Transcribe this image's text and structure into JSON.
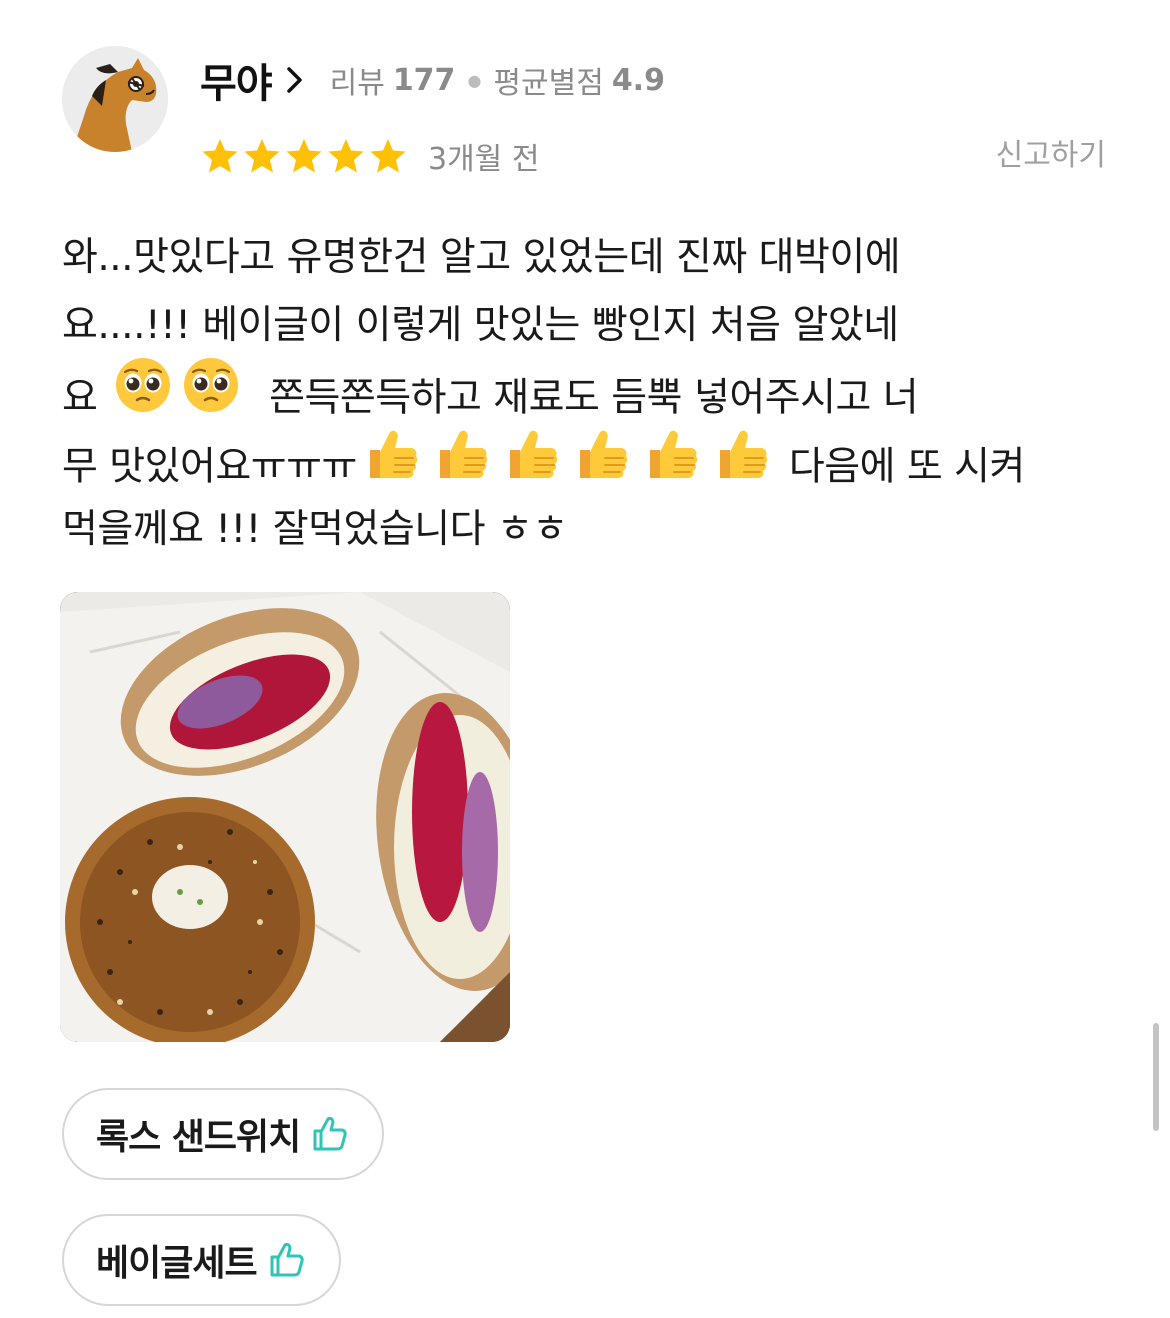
{
  "user": {
    "name": "무야",
    "review_label": "리뷰",
    "review_count": "177",
    "avg_label": "평균별점",
    "avg_rating": "4.9",
    "avatar_icon": "horse-avatar-icon"
  },
  "rating": {
    "stars": 5,
    "max": 5,
    "star_color": "#FFC107"
  },
  "date": "3개월 전",
  "report_label": "신고하기",
  "review_lines": [
    [
      {
        "t": "text",
        "v": "와...맛있다고 유명한건 알고 있었는데 진짜 대박이에"
      }
    ],
    [
      {
        "t": "text",
        "v": "요....!!! 베이글이 이렇게 맛있는 빵인지 처음 알았네"
      }
    ],
    [
      {
        "t": "text",
        "v": "요 "
      },
      {
        "t": "emoji",
        "v": "pleading-face"
      },
      {
        "t": "emoji",
        "v": "pleading-face"
      },
      {
        "t": "text",
        "v": "  쫀득쫀득하고 재료도 듬뿍 넣어주시고 너"
      }
    ],
    [
      {
        "t": "text",
        "v": "무 맛있어요ㅠㅠㅠ"
      },
      {
        "t": "emoji",
        "v": "thumbs-up"
      },
      {
        "t": "emoji",
        "v": "thumbs-up"
      },
      {
        "t": "emoji",
        "v": "thumbs-up"
      },
      {
        "t": "emoji",
        "v": "thumbs-up"
      },
      {
        "t": "emoji",
        "v": "thumbs-up"
      },
      {
        "t": "emoji",
        "v": "thumbs-up"
      },
      {
        "t": "text",
        "v": " 다음에 또 시켜"
      }
    ],
    [
      {
        "t": "text",
        "v": "먹을께요 !!! 잘먹었습니다 ㅎㅎ"
      }
    ]
  ],
  "photo_icon": "bagel-sandwich-photo",
  "menu_chips": [
    {
      "label": "록스 샌드위치",
      "icon": "thumbs-up-outline-icon"
    },
    {
      "label": "베이글세트",
      "icon": "thumbs-up-outline-icon"
    }
  ],
  "colors": {
    "accent_teal": "#2EC4B6",
    "meta_gray": "#8a8a8a"
  }
}
